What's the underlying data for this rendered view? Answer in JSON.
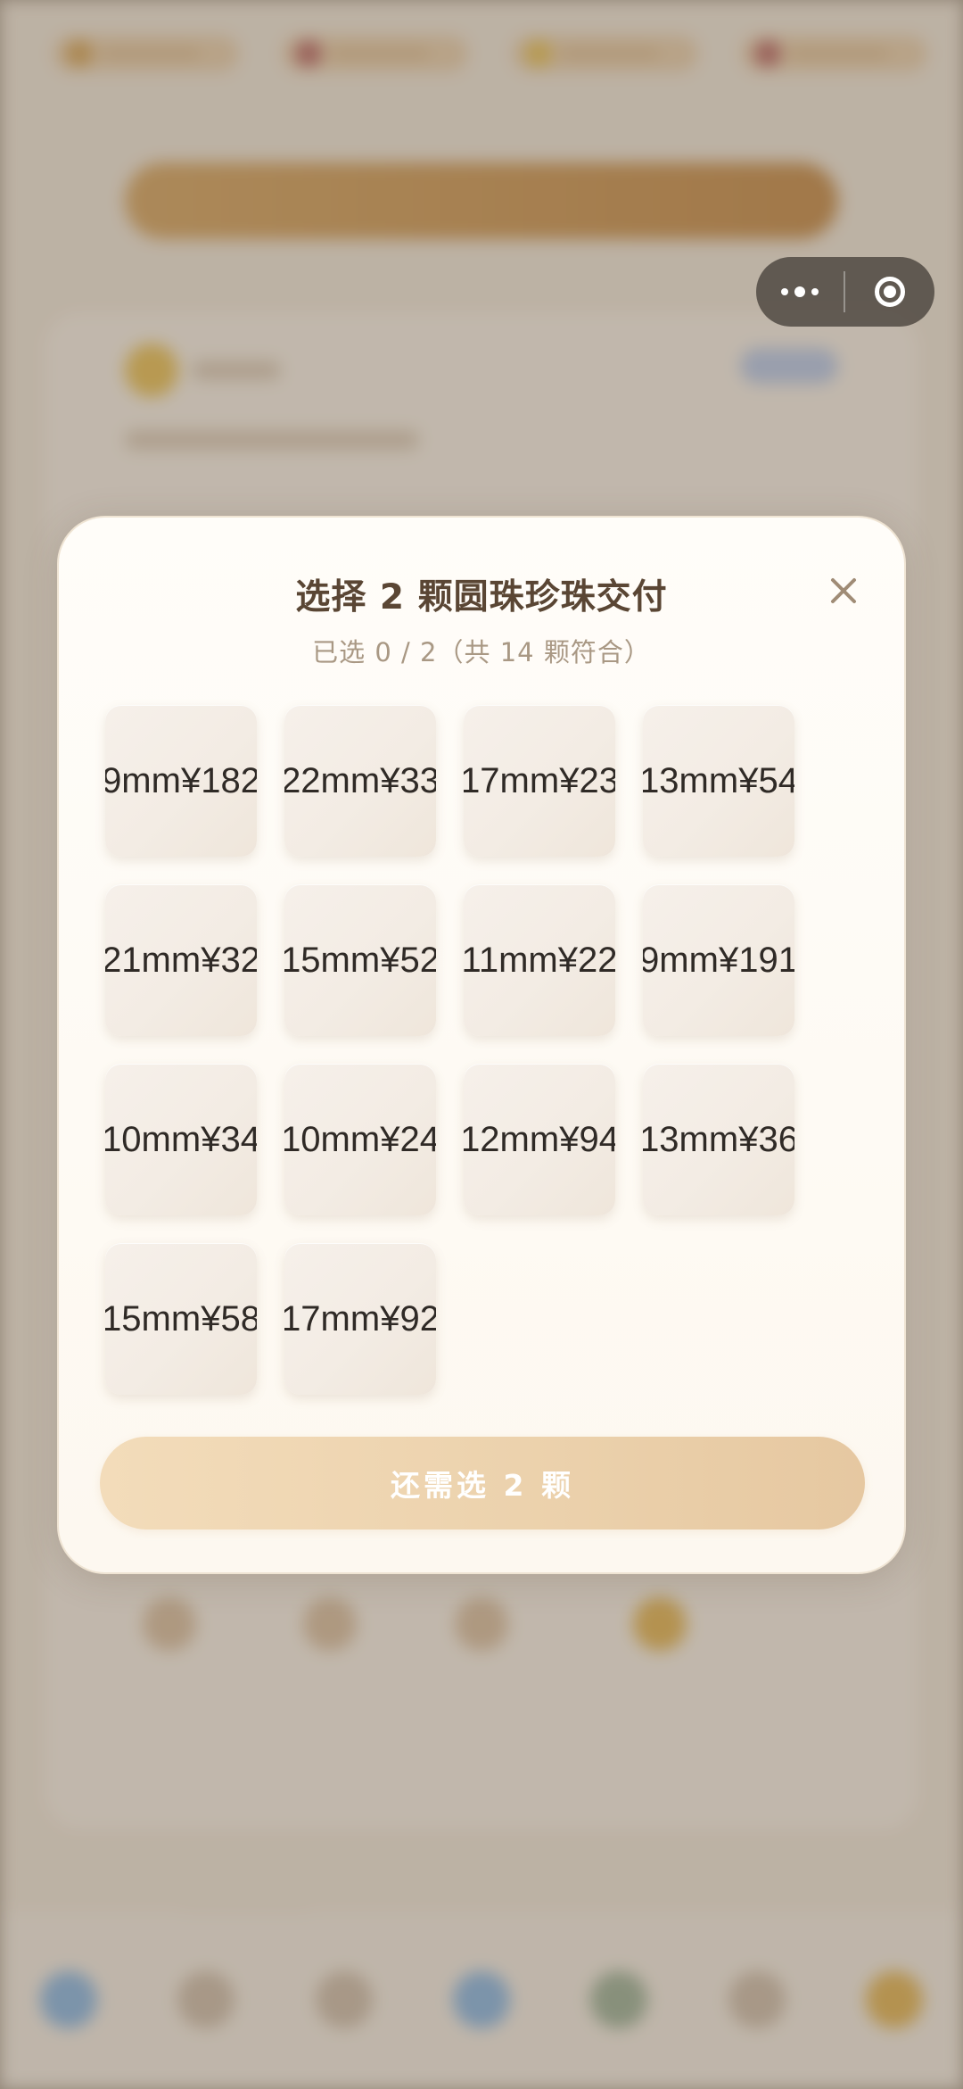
{
  "modal": {
    "title": "选择 2 颗圆珠珍珠交付",
    "subtitle": "已选 0 / 2（共 14 颗符合）",
    "confirm_label": "还需选 2 颗",
    "pearls": [
      {
        "label": "9mm¥182"
      },
      {
        "label": "22mm¥33"
      },
      {
        "label": "17mm¥23"
      },
      {
        "label": "13mm¥54"
      },
      {
        "label": "21mm¥32"
      },
      {
        "label": "15mm¥52"
      },
      {
        "label": "11mm¥22"
      },
      {
        "label": "9mm¥191"
      },
      {
        "label": "10mm¥34"
      },
      {
        "label": "10mm¥24"
      },
      {
        "label": "12mm¥94"
      },
      {
        "label": "13mm¥36"
      },
      {
        "label": "15mm¥58"
      },
      {
        "label": "17mm¥92"
      }
    ]
  },
  "capsule": {
    "more_icon": "more-dots-icon",
    "close_icon": "target-close-icon"
  },
  "colors": {
    "title": "#5a4634",
    "subtitle": "#a99884",
    "button_start": "#f3dcba",
    "button_end": "#e6c8a1",
    "close_icon": "#a08c76"
  }
}
